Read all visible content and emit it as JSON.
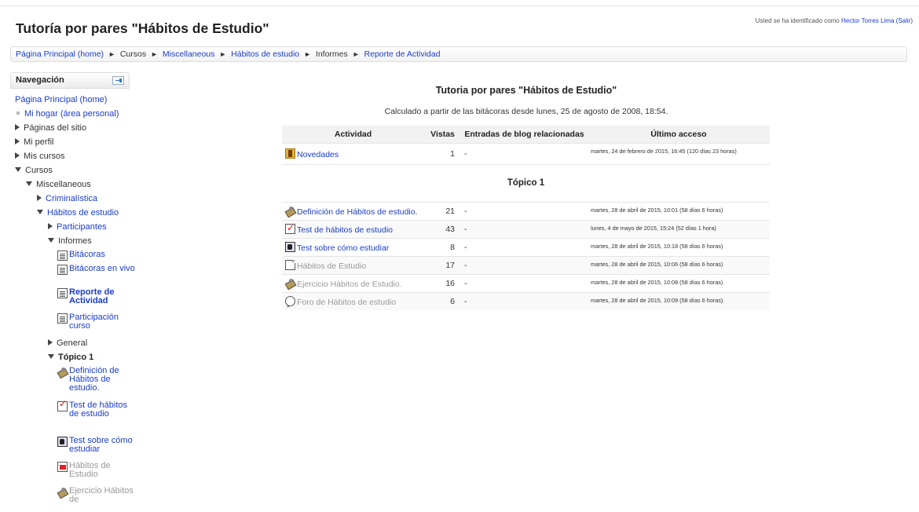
{
  "header": {
    "site_title": "Tutoría por pares \"Hábitos de Estudio\"",
    "login_prefix": "Usted se ha identificado como",
    "user_name": "Hector Torres Lima",
    "logout": "(Salir)"
  },
  "breadcrumb": [
    "Página Principal (home)",
    "Cursos",
    "Miscellaneous",
    "Hábitos de estudio",
    "Informes",
    "Reporte de Actividad"
  ],
  "breadcrumb_separator": "►",
  "sidebar": {
    "title": "Navegación",
    "items": {
      "home": "Página Principal (home)",
      "my_home": "Mi hogar (área personal)",
      "site_pages": "Páginas del sitio",
      "my_profile": "Mi perfil",
      "my_courses": "Mis cursos",
      "courses": "Cursos",
      "misc": "Miscellaneous",
      "criminalistica": "Criminalística",
      "habitos": "Hábitos de estudio",
      "participantes": "Participantes",
      "informes": "Informes",
      "bitacoras": "Bitácoras",
      "bitacoras_vivo": "Bitácoras en vivo",
      "reporte": "Reporte de Actividad",
      "participacion": "Participación curso",
      "general": "General",
      "topico": "Tópico 1",
      "definicion": "Definición de Hábitos de estudio.",
      "test_habitos": "Test de hábitos de estudio",
      "test_como": "Test sobre cómo estudiar",
      "habitos_estudio": "Hábitos de Estudio",
      "ejercicio": "Ejercicio Hábitos de"
    }
  },
  "report": {
    "title": "Tutoria por pares \"Hábitos de Estudio\"",
    "subtitle": "Calculado a partir de las bitácoras desde lunes, 25 de agosto de 2008, 18:54.",
    "columns": [
      "Actividad",
      "Vistas",
      "Entradas de blog relacionadas",
      "Último acceso"
    ],
    "news": {
      "name": "Novedades",
      "views": "1",
      "blog": "-",
      "last": "martes, 24 de febrero de 2015, 16:45 (120 días 23 horas)"
    },
    "section": "Tópico 1",
    "rows": [
      {
        "name": "Definición de Hábitos de estudio.",
        "views": "21",
        "blog": "-",
        "last": "martes, 28 de abril de 2015, 10:01 (58 días 6 horas)"
      },
      {
        "name": "Test de hábitos de estudio",
        "views": "43",
        "blog": "-",
        "last": "lunes, 4 de mayo de 2015, 15:24 (52 días 1 hora)"
      },
      {
        "name": "Test sobre cómo estudiar",
        "views": "8",
        "blog": "-",
        "last": "martes, 28 de abril de 2015, 10:18 (58 días 6 horas)"
      },
      {
        "name": "Hábitos de Estudio",
        "views": "17",
        "blog": "-",
        "last": "martes, 28 de abril de 2015, 10:06 (58 días 6 horas)"
      },
      {
        "name": "Ejercicio Hábitos de Estudio.",
        "views": "16",
        "blog": "-",
        "last": "martes, 28 de abril de 2015, 10:08 (58 días 6 horas)"
      },
      {
        "name": "Foro de Hábitos de estudio",
        "views": "6",
        "blog": "-",
        "last": "martes, 28 de abril de 2015, 10:09 (58 días 6 horas)"
      }
    ]
  }
}
